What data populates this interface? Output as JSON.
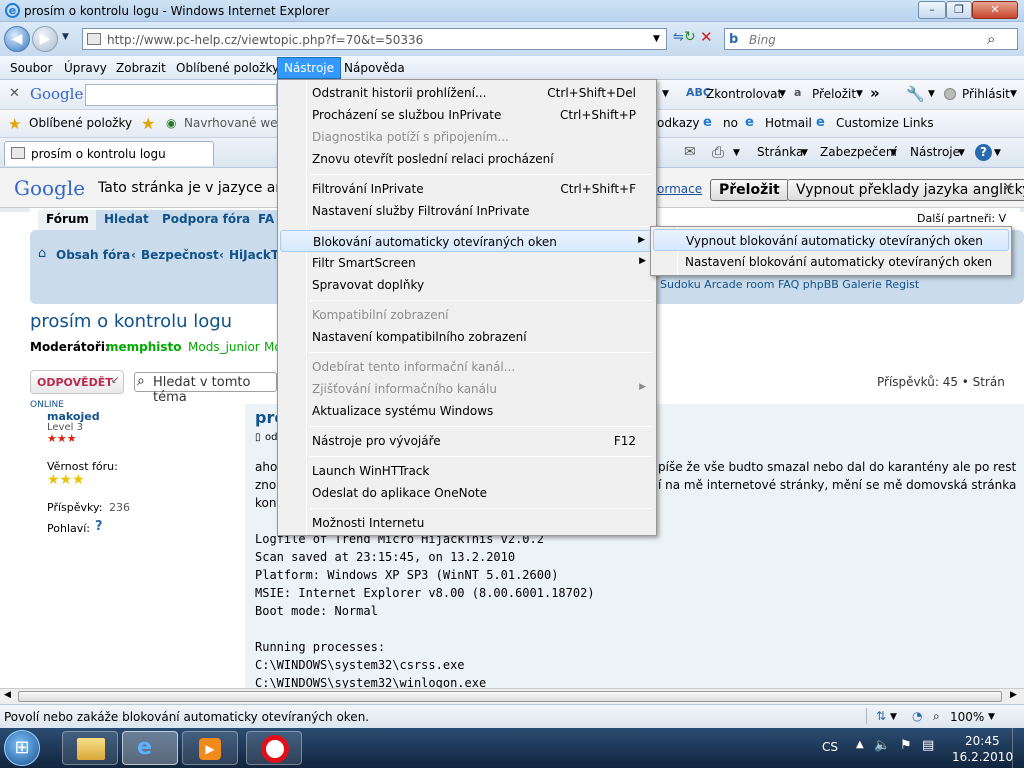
{
  "window": {
    "title": "prosím o kontrolu logu - Windows Internet Explorer"
  },
  "address": {
    "url": "http://www.pc-help.cz/viewtopic.php?f=70&t=50336",
    "search_placeholder": "Bing"
  },
  "menubar": {
    "items": [
      "Soubor",
      "Úpravy",
      "Zobrazit",
      "Oblíbené položky",
      "Nástroje",
      "Nápověda"
    ]
  },
  "googlebar": {
    "logo": "Google",
    "check": "Zkontrolovat",
    "translate": "Přeložit",
    "signin": "Přihlásit"
  },
  "favbar": {
    "favorites": "Oblíbené položky",
    "suggested": "Navrhované web",
    "links": "odkazy",
    "no": "no",
    "hotmail": "Hotmail",
    "custom": "Customize Links"
  },
  "tabrow": {
    "tab_title": "prosím o kontrolu logu",
    "page": "Stránka",
    "security": "Zabezpečení",
    "tools": "Nástroje"
  },
  "transbar": {
    "logo": "Google",
    "message": "Tato stránka je v jazyce ang",
    "info": "ormace",
    "translate_btn": "Přeložit",
    "disable_btn": "Vypnout překlady jazyka anglicky"
  },
  "forum": {
    "tabs": [
      "Fórum",
      "Hledat",
      "Podpora fóra",
      "FA"
    ],
    "partners": "Další partneři: V",
    "breadcrumb": [
      "Obsah fóra",
      "Bezpečnost",
      "HiJackT"
    ],
    "navlinks": "Sudoku  Arcade room  FAQ phpBB  Galerie  Regist",
    "topic_title": "prosím o kontrolu logu",
    "moderators_label": "Moderátoři:",
    "moderators": [
      "memphisto",
      "Mods_junior",
      "Mo"
    ],
    "reply_btn": "ODPOVĚDĚT",
    "search_placeholder": "Hledat v tomto téma",
    "post_count": "Příspěvků: 45 • Strán",
    "user": {
      "status": "ONLINE",
      "name": "makojed",
      "level": "Level 3",
      "loyalty": "Věrnost fóru:",
      "posts_label": "Příspěvky:",
      "posts": "236",
      "gender": "Pohlaví:"
    },
    "post": {
      "heading": "pro",
      "by": "od",
      "line1_start": "aho",
      "line1_end": "píše že vše budto smazal nebo dal do karantény ale po rest",
      "line2_start": "zno",
      "line2_end": "í na mě internetové stránky, mění se mě domovská stránka",
      "line3_start": "kon",
      "log": [
        "Logfile of Trend Micro HijackThis v2.0.2",
        "Scan saved at 23:15:45, on 13.2.2010",
        "Platform: Windows XP SP3 (WinNT 5.01.2600)",
        "MSIE: Internet Explorer v8.00 (8.00.6001.18702)",
        "Boot mode: Normal",
        "",
        "Running processes:",
        "C:\\WINDOWS\\system32\\csrss.exe",
        "C:\\WINDOWS\\system32\\winlogon.exe"
      ]
    }
  },
  "tools_menu": {
    "items": [
      {
        "label": "Odstranit historii prohlížení...",
        "shortcut": "Ctrl+Shift+Del",
        "disabled": false,
        "submenu": false
      },
      {
        "label": "Procházení se službou InPrivate",
        "shortcut": "Ctrl+Shift+P",
        "disabled": false,
        "submenu": false
      },
      {
        "label": "Diagnostika potíží s připojením...",
        "shortcut": "",
        "disabled": true,
        "submenu": false
      },
      {
        "label": "Znovu otevřít poslední relaci procházení",
        "shortcut": "",
        "disabled": false,
        "submenu": false
      },
      {
        "label": "Filtrování InPrivate",
        "shortcut": "Ctrl+Shift+F",
        "disabled": false,
        "submenu": false
      },
      {
        "label": "Nastavení služby Filtrování InPrivate",
        "shortcut": "",
        "disabled": false,
        "submenu": false
      },
      {
        "label": "Blokování automaticky otevíraných oken",
        "shortcut": "",
        "disabled": false,
        "submenu": true
      },
      {
        "label": "Filtr SmartScreen",
        "shortcut": "",
        "disabled": false,
        "submenu": true
      },
      {
        "label": "Spravovat doplňky",
        "shortcut": "",
        "disabled": false,
        "submenu": false
      },
      {
        "label": "Kompatibilní zobrazení",
        "shortcut": "",
        "disabled": true,
        "submenu": false
      },
      {
        "label": "Nastavení kompatibilního zobrazení",
        "shortcut": "",
        "disabled": false,
        "submenu": false
      },
      {
        "label": "Odebírat tento informační kanál...",
        "shortcut": "",
        "disabled": true,
        "submenu": false
      },
      {
        "label": "Zjišťování informačního kanálu",
        "shortcut": "",
        "disabled": true,
        "submenu": true
      },
      {
        "label": "Aktualizace systému Windows",
        "shortcut": "",
        "disabled": false,
        "submenu": false
      },
      {
        "label": "Nástroje pro vývojáře",
        "shortcut": "F12",
        "disabled": false,
        "submenu": false
      },
      {
        "label": "Launch WinHTTrack",
        "shortcut": "",
        "disabled": false,
        "submenu": false
      },
      {
        "label": "Odeslat do aplikace OneNote",
        "shortcut": "",
        "disabled": false,
        "submenu": false
      },
      {
        "label": "Možnosti Internetu",
        "shortcut": "",
        "disabled": false,
        "submenu": false
      }
    ]
  },
  "popup_submenu": {
    "items": [
      "Vypnout blokování automaticky otevíraných oken",
      "Nastavení blokování automaticky otevíraných oken"
    ]
  },
  "statusbar": {
    "text": "Povolí nebo zakáže blokování automaticky otevíraných oken.",
    "zoom": "100%"
  },
  "taskbar": {
    "lang": "CS",
    "time": "20:45",
    "date": "16.2.2010"
  }
}
